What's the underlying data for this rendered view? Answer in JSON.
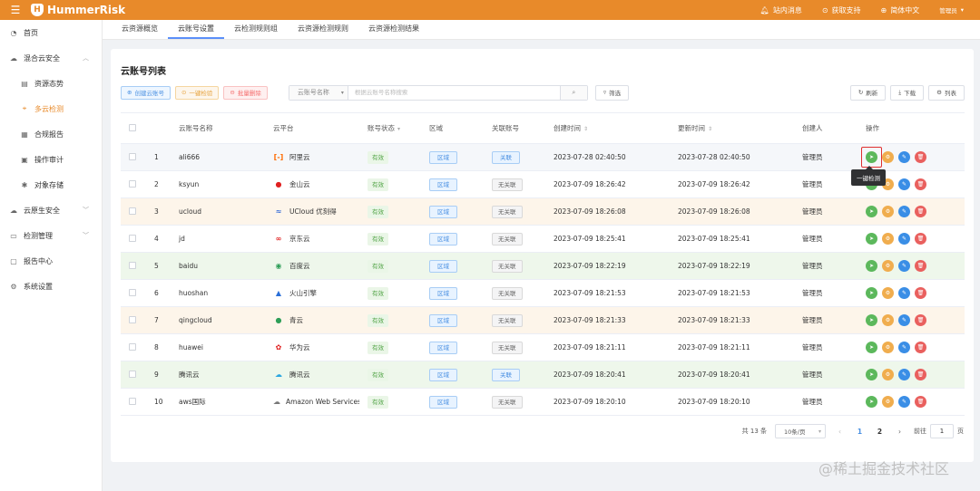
{
  "topbar": {
    "menu_icon": "hamburger-icon",
    "brand": "HummerRisk",
    "items": [
      {
        "icon": "bell-icon",
        "label": "站内消息"
      },
      {
        "icon": "support-icon",
        "label": "获取支持"
      },
      {
        "icon": "globe-icon",
        "label": "简体中文"
      }
    ],
    "user": "管理员"
  },
  "sidebar": {
    "items": [
      {
        "icon": "home-icon",
        "label": "首页",
        "level": 1
      },
      {
        "icon": "cloud-icon",
        "label": "混合云安全",
        "level": 1,
        "expanded": true
      },
      {
        "icon": "chart-icon",
        "label": "资源态势",
        "level": 2
      },
      {
        "icon": "scan-icon",
        "label": "多云检测",
        "level": 2,
        "active": true
      },
      {
        "icon": "report-icon",
        "label": "合规报告",
        "level": 2
      },
      {
        "icon": "audit-icon",
        "label": "操作审计",
        "level": 2
      },
      {
        "icon": "storage-icon",
        "label": "对象存储",
        "level": 2
      },
      {
        "icon": "native-cloud-icon",
        "label": "云原生安全",
        "level": 1,
        "expanded": false
      },
      {
        "icon": "detect-icon",
        "label": "检测管理",
        "level": 1,
        "expanded": false
      },
      {
        "icon": "report-center-icon",
        "label": "报告中心",
        "level": 1
      },
      {
        "icon": "settings-icon",
        "label": "系统设置",
        "level": 1
      }
    ]
  },
  "tabs": [
    {
      "label": "云资源概览",
      "active": false
    },
    {
      "label": "云账号设置",
      "active": true
    },
    {
      "label": "云检测规则组",
      "active": false
    },
    {
      "label": "云资源检测规则",
      "active": false
    },
    {
      "label": "云资源检测结果",
      "active": false
    }
  ],
  "card": {
    "title": "云账号列表",
    "toolbar": {
      "create": "创建云账号",
      "check": "一键检验",
      "batch_delete": "批量删除",
      "search_field": "云账号名称",
      "search_placeholder": "根据云账号名称搜索",
      "filter": "筛选",
      "refresh": "刷新",
      "download": "下载",
      "columns": "列表"
    }
  },
  "table": {
    "headers": [
      "",
      "",
      "云账号名称",
      "云平台",
      "账号状态",
      "区域",
      "关联账号",
      "创建时间",
      "更新时间",
      "创建人",
      "操作"
    ],
    "rows": [
      {
        "idx": "1",
        "name": "ali666",
        "platform": "阿里云",
        "picon": "aliyun-icon",
        "pchar": "[-]",
        "pcolor": "#ff6a00",
        "status": "有效",
        "zone": "区域",
        "link": "关联",
        "linked": true,
        "created": "2023-07-28 02:40:50",
        "updated": "2023-07-28 02:40:50",
        "creator": "管理员",
        "style": "r-hover"
      },
      {
        "idx": "2",
        "name": "ksyun",
        "platform": "金山云",
        "picon": "ksyun-icon",
        "pchar": "●",
        "pcolor": "#e02020",
        "status": "有效",
        "zone": "区域",
        "link": "无关联",
        "linked": false,
        "created": "2023-07-09 18:26:42",
        "updated": "2023-07-09 18:26:42",
        "creator": "管理员",
        "style": ""
      },
      {
        "idx": "3",
        "name": "ucloud",
        "platform": "UCloud 优刻得",
        "picon": "ucloud-icon",
        "pchar": "≈",
        "pcolor": "#3a6fd8",
        "status": "有效",
        "zone": "区域",
        "link": "无关联",
        "linked": false,
        "created": "2023-07-09 18:26:08",
        "updated": "2023-07-09 18:26:08",
        "creator": "管理员",
        "style": "r-orange"
      },
      {
        "idx": "4",
        "name": "jd",
        "platform": "京东云",
        "picon": "jdcloud-icon",
        "pchar": "∞",
        "pcolor": "#e02020",
        "status": "有效",
        "zone": "区域",
        "link": "无关联",
        "linked": false,
        "created": "2023-07-09 18:25:41",
        "updated": "2023-07-09 18:25:41",
        "creator": "管理员",
        "style": ""
      },
      {
        "idx": "5",
        "name": "baidu",
        "platform": "百度云",
        "picon": "baidu-icon",
        "pchar": "◉",
        "pcolor": "#2e9e58",
        "status": "有效",
        "zone": "区域",
        "link": "无关联",
        "linked": false,
        "created": "2023-07-09 18:22:19",
        "updated": "2023-07-09 18:22:19",
        "creator": "管理员",
        "style": "r-green"
      },
      {
        "idx": "6",
        "name": "huoshan",
        "platform": "火山引擎",
        "picon": "volcengine-icon",
        "pchar": "▲",
        "pcolor": "#2a6fd8",
        "status": "有效",
        "zone": "区域",
        "link": "无关联",
        "linked": false,
        "created": "2023-07-09 18:21:53",
        "updated": "2023-07-09 18:21:53",
        "creator": "管理员",
        "style": ""
      },
      {
        "idx": "7",
        "name": "qingcloud",
        "platform": "青云",
        "picon": "qingcloud-icon",
        "pchar": "●",
        "pcolor": "#2e9e58",
        "status": "有效",
        "zone": "区域",
        "link": "无关联",
        "linked": false,
        "created": "2023-07-09 18:21:33",
        "updated": "2023-07-09 18:21:33",
        "creator": "管理员",
        "style": "r-orange"
      },
      {
        "idx": "8",
        "name": "huawei",
        "platform": "华为云",
        "picon": "huawei-icon",
        "pchar": "✿",
        "pcolor": "#e02020",
        "status": "有效",
        "zone": "区域",
        "link": "无关联",
        "linked": false,
        "created": "2023-07-09 18:21:11",
        "updated": "2023-07-09 18:21:11",
        "creator": "管理员",
        "style": ""
      },
      {
        "idx": "9",
        "name": "腾讯云",
        "platform": "腾讯云",
        "picon": "tencent-icon",
        "pchar": "☁",
        "pcolor": "#2aa6e0",
        "status": "有效",
        "zone": "区域",
        "link": "关联",
        "linked": true,
        "created": "2023-07-09 18:20:41",
        "updated": "2023-07-09 18:20:41",
        "creator": "管理员",
        "style": "r-green"
      },
      {
        "idx": "10",
        "name": "aws国际",
        "platform": "Amazon Web Services",
        "picon": "aws-icon",
        "pchar": "☁",
        "pcolor": "#777777",
        "status": "有效",
        "zone": "区域",
        "link": "无关联",
        "linked": false,
        "created": "2023-07-09 18:20:10",
        "updated": "2023-07-09 18:20:10",
        "creator": "管理员",
        "style": ""
      }
    ]
  },
  "tooltip": "一键检测",
  "pagination": {
    "total": "共 13 条",
    "page_size": "10条/页",
    "prev": "‹",
    "pages": [
      "1",
      "2"
    ],
    "current": "1",
    "next": "›",
    "goto_label": "前往",
    "goto_value": "1",
    "page_suffix": "页"
  },
  "watermark": "@稀土掘金技术社区"
}
